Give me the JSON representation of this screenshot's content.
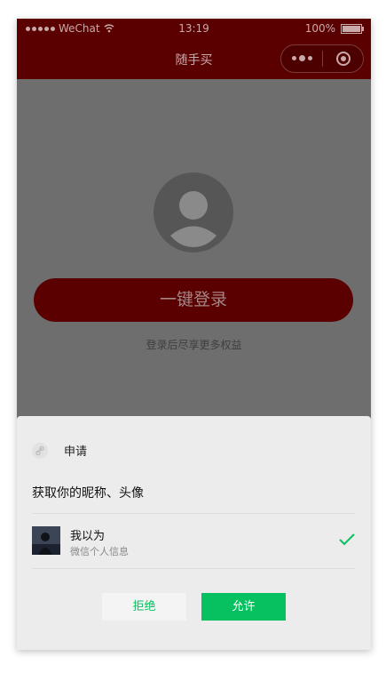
{
  "status_bar": {
    "carrier": "WeChat",
    "time": "13:19",
    "battery": "100%"
  },
  "nav": {
    "title": "随手买"
  },
  "page": {
    "login_button": "一键登录",
    "hint": "登录后尽享更多权益"
  },
  "dialog": {
    "app_label": "申请",
    "request_title": "获取你的昵称、头像",
    "user_name": "我以为",
    "user_subtitle": "微信个人信息",
    "reject_label": "拒绝",
    "allow_label": "允许"
  },
  "colors": {
    "brand": "#5a0000",
    "wechat_green": "#07c160",
    "overlay": "#6e6e6e"
  }
}
